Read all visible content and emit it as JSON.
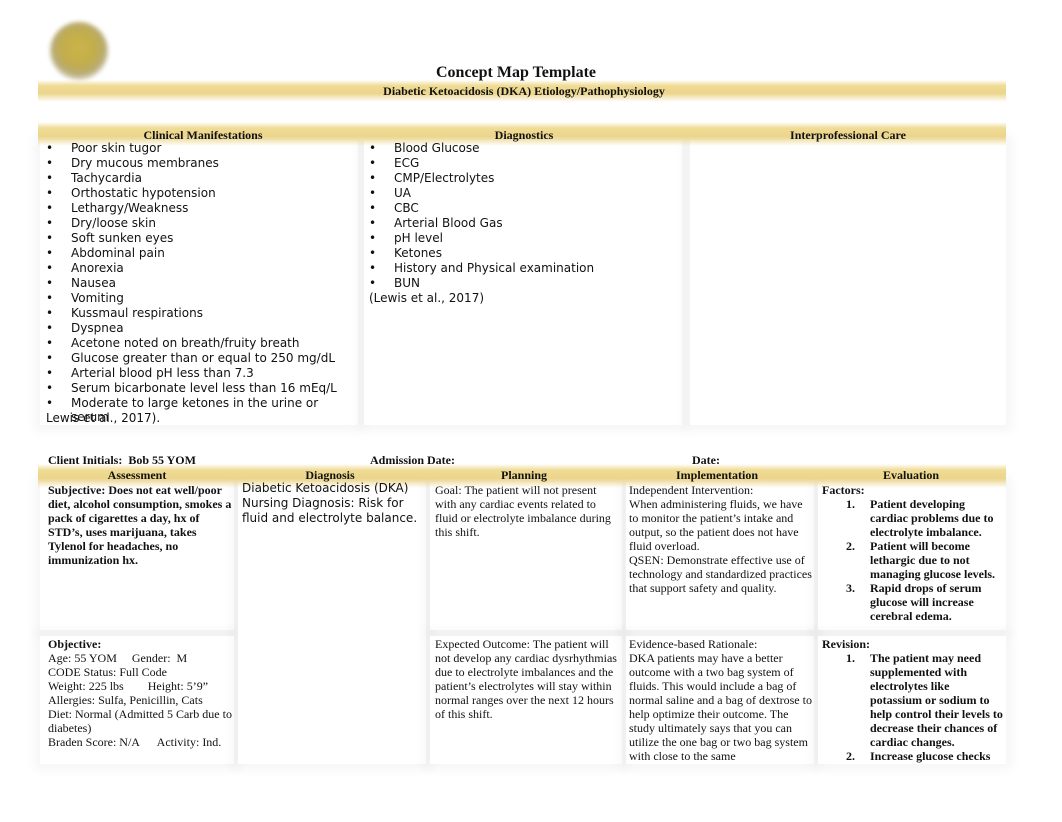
{
  "header": {
    "title": "Concept Map Template",
    "subtitle": "Diabetic Ketoacidosis (DKA) Etiology/Pathophysiology"
  },
  "top_section": {
    "clinical_manifestations": {
      "heading": "Clinical Manifestations",
      "items": [
        "Poor skin tugor",
        "Dry mucous membranes",
        "Tachycardia",
        "Orthostatic hypotension",
        "Lethargy/Weakness",
        "Dry/loose skin",
        "Soft sunken eyes",
        "Abdominal pain",
        "Anorexia",
        "Nausea",
        "Vomiting",
        "Kussmaul respirations",
        "Dyspnea",
        "Acetone noted on breath/fruity breath",
        "Glucose greater than or equal to 250 mg/dL",
        "Arterial blood pH less than 7.3",
        "Serum bicarbonate level less than 16 mEq/L",
        "Moderate to large ketones in the urine or serum"
      ],
      "citation": "Lewis et al., 2017)."
    },
    "diagnostics": {
      "heading": "Diagnostics",
      "items": [
        "Blood Glucose",
        "ECG",
        "CMP/Electrolytes",
        "UA",
        "CBC",
        "Arterial Blood Gas",
        "pH level",
        "Ketones",
        "History and Physical examination",
        "BUN"
      ],
      "citation": "(Lewis et al., 2017)"
    },
    "interprofessional_care": {
      "heading": "Interprofessional Care",
      "content": ""
    }
  },
  "client_info": {
    "client_initials_label": "Client Initials:",
    "client_initials_value": "Bob 55 YOM",
    "admission_date_label": "Admission Date:",
    "date_label": "Date:"
  },
  "care_plan": {
    "columns": [
      "Assessment",
      "Diagnosis",
      "Planning",
      "Implementation",
      "Evaluation"
    ],
    "assessment": {
      "subjective": "Subjective: Does not eat well/poor diet, alcohol consumption, smokes a pack of cigarettes a day, hx of STD’s, uses marijuana, takes Tylenol for headaches, no immunization hx.",
      "objective_label": "Objective:",
      "objective_lines": [
        "Age: 55 YOM     Gender:  M",
        "CODE Status: Full Code",
        "Weight: 225 lbs        Height: 5’9”",
        "Allergies: Sulfa, Penicillin, Cats",
        "Diet: Normal (Admitted 5 Carb due to diabetes)",
        "Braden Score: N/A      Activity: Ind."
      ]
    },
    "diagnosis": {
      "medical": "Diabetic Ketoacidosis (DKA)",
      "nursing": "Nursing Diagnosis: Risk for fluid and electrolyte balance."
    },
    "planning": {
      "goal": "Goal: The patient will not present with any cardiac events related to fluid or electrolyte imbalance during this shift.",
      "expected_outcome": "Expected Outcome: The patient will not develop any cardiac dysrhythmias due to electrolyte imbalances and the patient’s electrolytes will stay within normal ranges over the next 12 hours of this shift."
    },
    "implementation": {
      "intervention_label": "Independent Intervention:",
      "intervention": "When administering fluids, we have to monitor the patient’s intake and output, so the patient does not have fluid overload.",
      "qsen": "QSEN: Demonstrate effective use of technology and standardized practices that support safety and quality.",
      "rationale_label": "Evidence-based Rationale:",
      "rationale": "DKA patients may have a better outcome with a two bag system of fluids.  This would include a bag of normal saline and a bag of dextrose to help optimize their outcome.  The study ultimately says that you can utilize the one bag or two bag system with close to the same"
    },
    "evaluation": {
      "factors_label": "Factors:",
      "factors": [
        {
          "num": "1.",
          "text": "Patient developing cardiac problems due to electrolyte imbalance."
        },
        {
          "num": "2.",
          "text": "Patient will become lethargic due to not managing glucose levels."
        },
        {
          "num": "3.",
          "text": "Rapid drops of serum glucose will increase cerebral edema."
        }
      ],
      "revision_label": "Revision:",
      "revisions": [
        {
          "num": "1.",
          "text": "The patient may need supplemented with electrolytes like potassium or sodium to help control their levels to decrease their chances of cardiac changes."
        },
        {
          "num": "2.",
          "text": "Increase glucose checks"
        }
      ]
    }
  }
}
